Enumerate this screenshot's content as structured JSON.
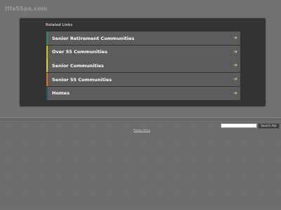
{
  "site": {
    "domain": "fifa55pa.com"
  },
  "related": {
    "title": "Related Links",
    "links": [
      {
        "label": "Senior Retirement Communities",
        "stripe_color": "#2a8a7a"
      },
      {
        "label": "Over 55 Communities",
        "stripe_color": "#c8c020"
      },
      {
        "label": "Senior Communities",
        "stripe_color": "#e0d048"
      },
      {
        "label": "Senior 55 Communities",
        "stripe_color": "#e07020"
      },
      {
        "label": "Homes",
        "stripe_color": "#1a5a6a"
      }
    ],
    "arrow_icon": "right-arrow-icon",
    "arrow_color": "#d7e44a"
  },
  "footer": {
    "privacy_label": "Privacy Policy",
    "search_value": "",
    "search_button_label": "Search Ads"
  }
}
